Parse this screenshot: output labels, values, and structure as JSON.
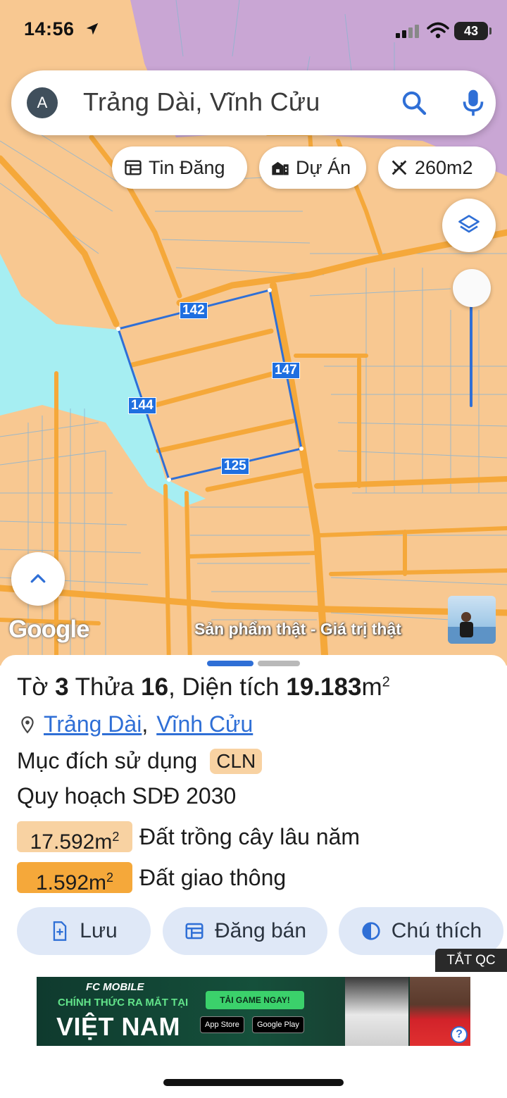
{
  "status_bar": {
    "time": "14:56",
    "battery": "43"
  },
  "search": {
    "avatar_letter": "A",
    "query": "Trảng Dài, Vĩnh Cửu"
  },
  "chips": [
    {
      "label": "Tin Đăng",
      "icon": "listing-icon"
    },
    {
      "label": "Dự Án",
      "icon": "project-icon"
    },
    {
      "label": "260m2",
      "icon": "measure-icon"
    }
  ],
  "map": {
    "edge_lengths": [
      "142",
      "147",
      "144",
      "125"
    ],
    "google_logo": "Google",
    "tagline": "Sản phẩm thật - Giá trị thật"
  },
  "parcel": {
    "sheet_prefix": "Tờ",
    "sheet_no": "3",
    "plot_prefix": "Thửa",
    "plot_no": "16",
    "area_prefix": ", Diện tích",
    "area_value": "19.183",
    "area_unit": "m",
    "area_sup": "2",
    "ward": "Trảng Dài",
    "district": "Vĩnh Cửu",
    "purpose_label": "Mục đích sử dụng",
    "purpose_code": "CLN",
    "plan_label": "Quy hoạch SDĐ 2030",
    "zones": [
      {
        "area": "17.592m",
        "sup": "2",
        "label": "Đất trồng cây lâu năm",
        "color": "#f8d2a2"
      },
      {
        "area": "1.592m",
        "sup": "2",
        "label": "Đất giao thông",
        "color": "#f5a83a"
      }
    ]
  },
  "actions": {
    "save": "Lưu",
    "sell": "Đăng bán",
    "legend": "Chú thích"
  },
  "ad": {
    "close_label": "TẮT QC",
    "brand": "FC MOBILE",
    "line1": "CHÍNH THỨC RA MẮT TẠI",
    "line2": "VIỆT NAM",
    "cta": "TẢI GAME NGAY!",
    "app_store": "App Store",
    "google_play": "Google Play"
  },
  "colors": {
    "accent": "#2f6fd6",
    "land": "#f8c891",
    "road": "#f5a83a",
    "water": "#a6eef2",
    "plot_edge": "#2f6fd6"
  }
}
